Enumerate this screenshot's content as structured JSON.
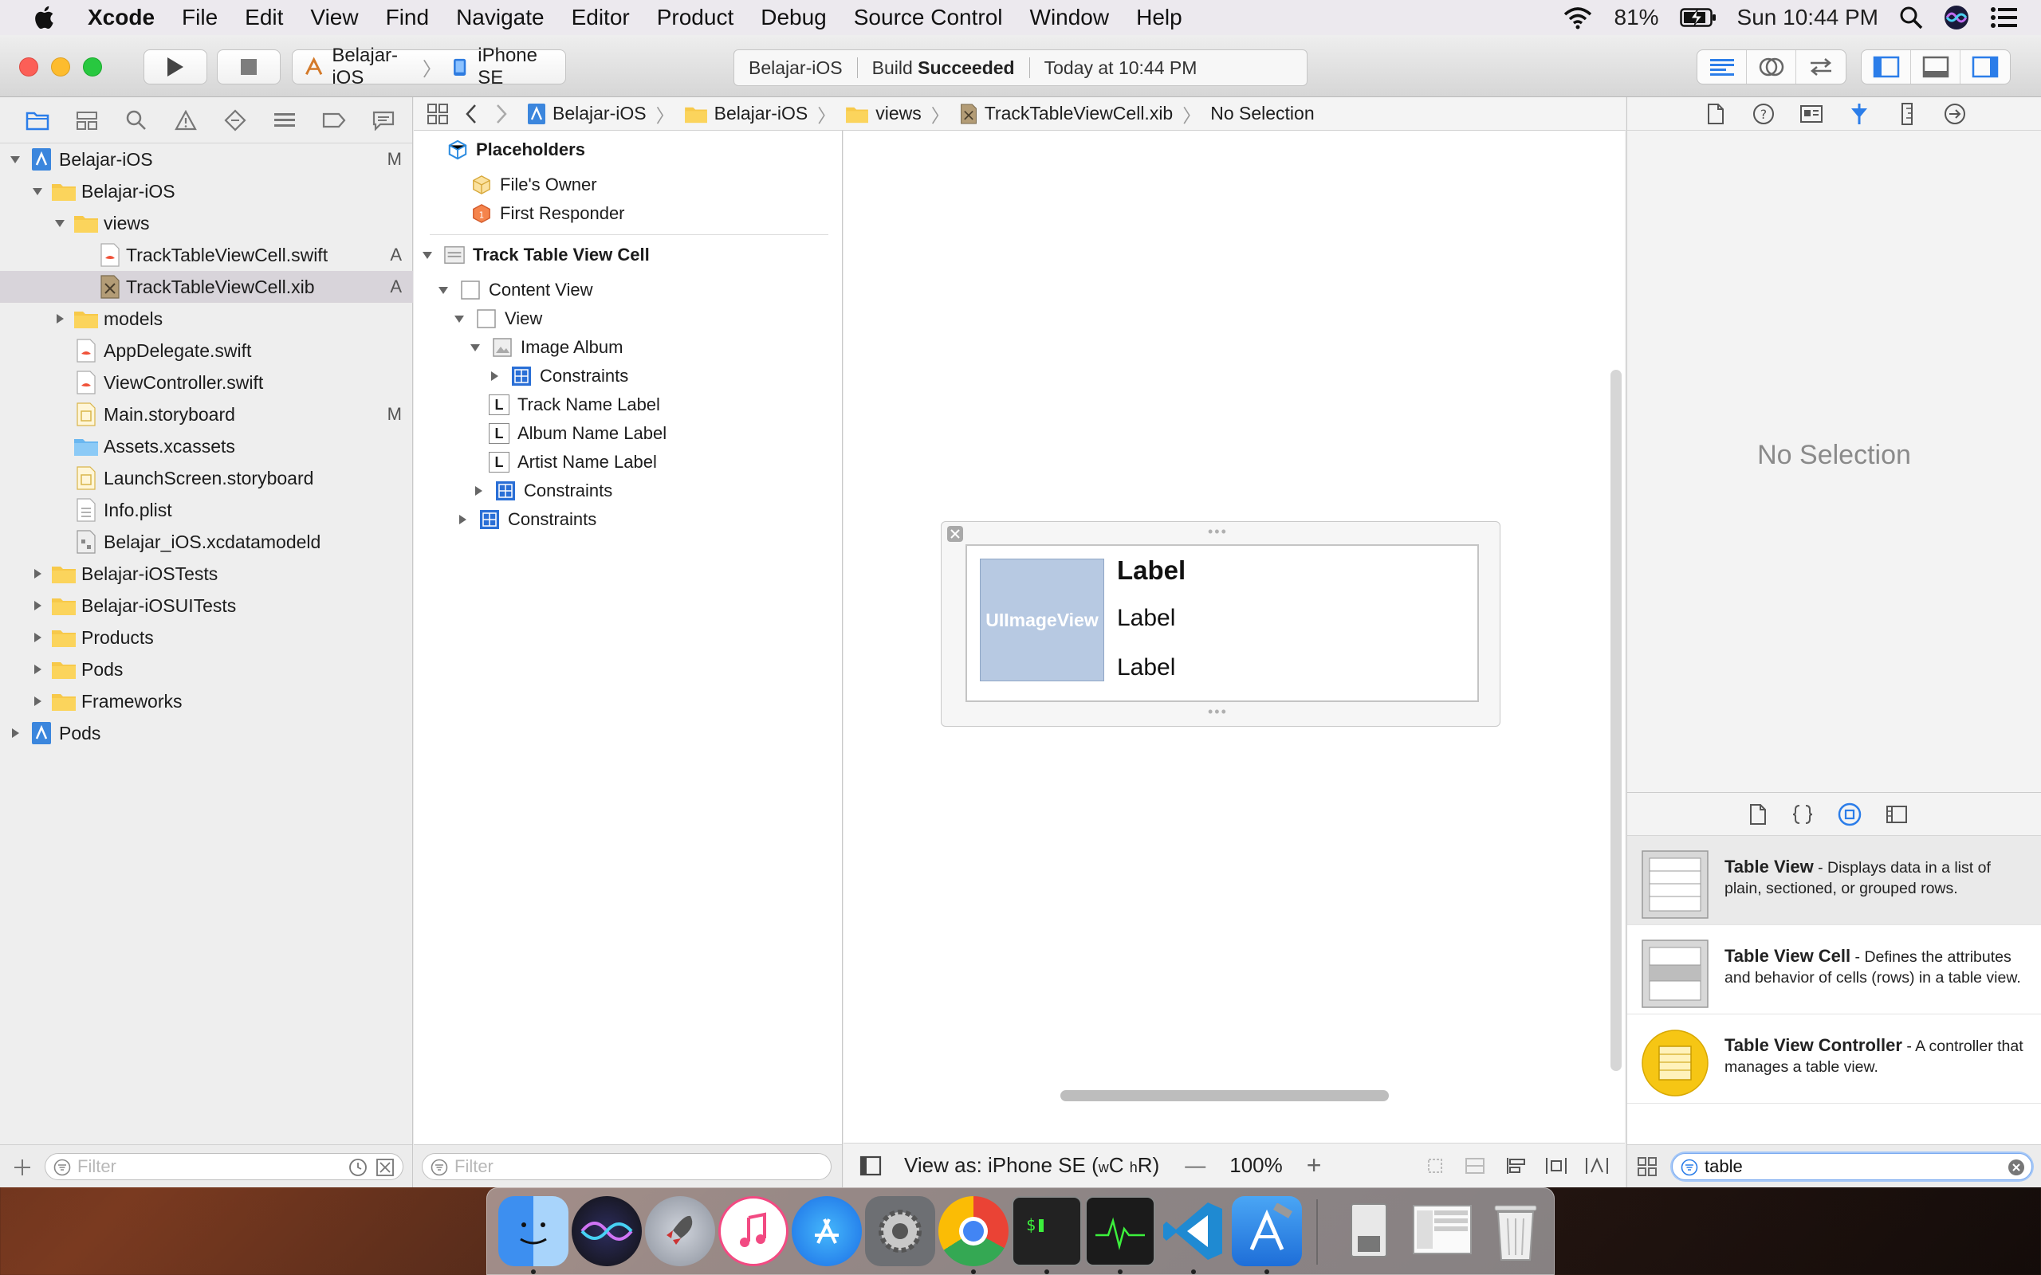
{
  "menubar": {
    "app": "Xcode",
    "items": [
      "File",
      "Edit",
      "View",
      "Find",
      "Navigate",
      "Editor",
      "Product",
      "Debug",
      "Source Control",
      "Window",
      "Help"
    ],
    "battery": "81%",
    "clock": "Sun 10:44 PM"
  },
  "toolbar": {
    "scheme": "Belajar-iOS",
    "device": "iPhone SE",
    "activity": {
      "project": "Belajar-iOS",
      "build_prefix": "Build",
      "build_status": "Succeeded",
      "time": "Today at 10:44 PM"
    }
  },
  "navigator": {
    "items": [
      {
        "label": "Belajar-iOS",
        "badge": "M"
      },
      {
        "label": "Belajar-iOS",
        "badge": ""
      },
      {
        "label": "views",
        "badge": ""
      },
      {
        "label": "TrackTableViewCell.swift",
        "badge": "A"
      },
      {
        "label": "TrackTableViewCell.xib",
        "badge": "A"
      },
      {
        "label": "models",
        "badge": ""
      },
      {
        "label": "AppDelegate.swift",
        "badge": ""
      },
      {
        "label": "ViewController.swift",
        "badge": ""
      },
      {
        "label": "Main.storyboard",
        "badge": "M"
      },
      {
        "label": "Assets.xcassets",
        "badge": ""
      },
      {
        "label": "LaunchScreen.storyboard",
        "badge": ""
      },
      {
        "label": "Info.plist",
        "badge": ""
      },
      {
        "label": "Belajar_iOS.xcdatamodeld",
        "badge": ""
      },
      {
        "label": "Belajar-iOSTests",
        "badge": ""
      },
      {
        "label": "Belajar-iOSUITests",
        "badge": ""
      },
      {
        "label": "Products",
        "badge": ""
      },
      {
        "label": "Pods",
        "badge": ""
      },
      {
        "label": "Frameworks",
        "badge": ""
      },
      {
        "label": "Pods",
        "badge": ""
      }
    ],
    "filter_placeholder": "Filter"
  },
  "jumpbar": {
    "crumbs": [
      "Belajar-iOS",
      "Belajar-iOS",
      "views",
      "TrackTableViewCell.xib",
      "No Selection"
    ]
  },
  "outline": {
    "placeholders_title": "Placeholders",
    "files_owner": "File's Owner",
    "first_responder": "First Responder",
    "cell": "Track Table View Cell",
    "content_view": "Content View",
    "view": "View",
    "image_album": "Image Album",
    "constraints": "Constraints",
    "track_name": "Track Name Label",
    "album_name": "Album Name Label",
    "artist_name": "Artist Name Label",
    "filter_placeholder": "Filter"
  },
  "canvas": {
    "image_view_text": "UIImageView",
    "label_title": "Label",
    "label_2": "Label",
    "label_3": "Label",
    "view_as": "View as: iPhone SE (",
    "size_w": "w",
    "size_C": "C",
    "size_h": "h",
    "size_R": "R)",
    "zoom": "100%"
  },
  "inspector": {
    "no_selection": "No Selection"
  },
  "library": {
    "items": [
      {
        "title": "Table View",
        "desc": " - Displays data in a list of plain, sectioned, or grouped rows."
      },
      {
        "title": "Table View Cell",
        "desc": " - Defines the attributes and behavior of cells (rows) in a table view."
      },
      {
        "title": "Table View Controller",
        "desc": " - A controller that manages a table view."
      }
    ],
    "search_value": "table"
  }
}
